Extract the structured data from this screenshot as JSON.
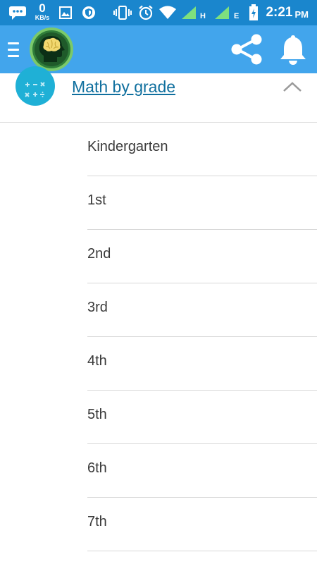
{
  "status_bar": {
    "data_speed_value": "0",
    "data_speed_unit": "KB/s",
    "network_1_letter": "H",
    "network_2_letter": "E",
    "time": "2:21",
    "ampm": "PM",
    "icons": [
      "chat-bubble-icon",
      "image-icon",
      "vpn-shield-icon",
      "vibrate-icon",
      "alarm-icon",
      "wifi-icon",
      "signal-icon",
      "signal-icon",
      "battery-charging-icon"
    ]
  },
  "app_bar": {
    "background": "#42a5ec",
    "icons": [
      "menu-icon",
      "brain-logo-icon",
      "share-icon",
      "bell-icon"
    ]
  },
  "section": {
    "title": "Math by grade",
    "icon": "math-operators-icon",
    "title_color": "#0f6f9e"
  },
  "grades": [
    {
      "label": "Kindergarten"
    },
    {
      "label": "1st"
    },
    {
      "label": "2nd"
    },
    {
      "label": "3rd"
    },
    {
      "label": "4th"
    },
    {
      "label": "5th"
    },
    {
      "label": "6th"
    },
    {
      "label": "7th"
    }
  ]
}
